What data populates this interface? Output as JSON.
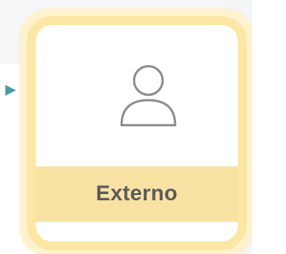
{
  "card": {
    "label": "Externo",
    "icon": "user-icon"
  },
  "colors": {
    "card_border": "#fde7a5",
    "label_band": "#f8e2a3",
    "label_text": "#5a5a5a",
    "arrow": "#4a9ba2",
    "icon_stroke": "#8b8b8b"
  }
}
